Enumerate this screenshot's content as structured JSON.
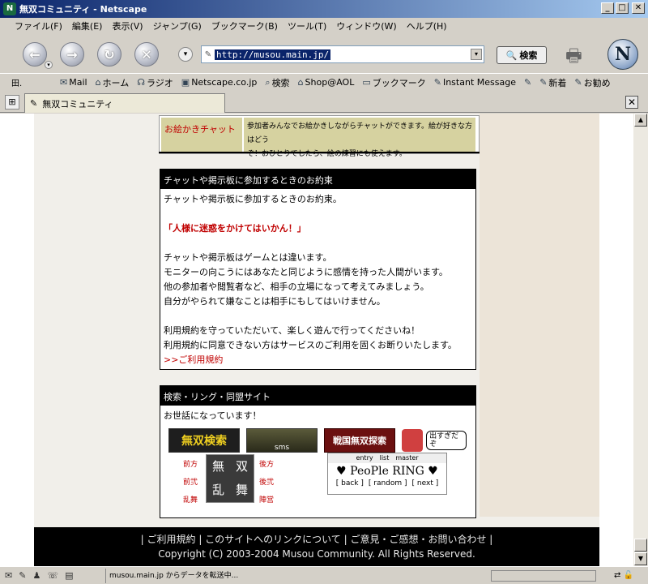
{
  "window": {
    "title": "無双コミュニティ - Netscape",
    "min": "_",
    "max": "□",
    "close": "✕"
  },
  "menu": [
    "ファイル(F)",
    "編集(E)",
    "表示(V)",
    "ジャンプ(G)",
    "ブックマーク(B)",
    "ツール(T)",
    "ウィンドウ(W)",
    "ヘルプ(H)"
  ],
  "nav": {
    "url": "http://musou.main.jp/",
    "search_label": "検索"
  },
  "personal": {
    "home_icon_label": "田.",
    "items": [
      "Mail",
      "ホーム",
      "ラジオ",
      "Netscape.co.jp",
      "検索",
      "Shop@AOL",
      "ブックマーク",
      "Instant Message",
      "",
      "新着",
      "お勧め"
    ]
  },
  "tab": {
    "title": "無双コミュニティ"
  },
  "content": {
    "oekaki_title": "お絵かきチャット",
    "oekaki_desc_1": "参加者みんなでお絵かきしながらチャットができます。絵が好きな方はどう",
    "oekaki_desc_2": "ぞ！おひとりでしたら、絵の練習にも使えます。",
    "rules_head": "チャットや掲示板に参加するときのお約束",
    "rules_intro": "チャットや掲示板に参加するときのお約束。",
    "rules_slogan": "「人様に迷惑をかけてはいかん！」",
    "rules_lines": [
      "チャットや掲示板はゲームとは違います。",
      "モニターの向こうにはあなたと同じように感情を持った人間がいます。",
      "他の参加者や閲覧者など、相手の立場になって考えてみましょう。",
      "自分がやられて嫌なことは相手にもしてはいけません。"
    ],
    "rules_outro_1": "利用規約を守っていただいて、楽しく遊んで行ってくださいね！",
    "rules_outro_2": "利用規約に同意できない方はサービスのご利用を固くお断りいたします。",
    "rules_link": ">>ご利用規約",
    "links_head": "検索・リング・同盟サイト",
    "links_intro": "お世話になっています！",
    "banner1": "無双検索",
    "banner2": "sms",
    "banner3": "戦国無双探索",
    "banner4_bubble": "出すぎだぞ",
    "muso_left": [
      "前方",
      "前弐",
      "乱舞"
    ],
    "muso_logo": [
      "無",
      "双",
      "乱",
      "舞"
    ],
    "muso_right": [
      "後方",
      "後弐",
      "陣営"
    ],
    "ring_tabs": [
      "entry",
      "list",
      "master"
    ],
    "ring_title": "♥ PeoPle RING ♥",
    "ring_nav": [
      "[ back ]",
      "[ random ]",
      "[ next ]"
    ]
  },
  "footer": {
    "links": "| ご利用規約 | このサイトへのリンクについて | ご意見・ご感想・お問い合わせ |",
    "copyright": "Copyright (C) 2003-2004 Musou Community. All Rights Reserved."
  },
  "status": {
    "message": "musou.main.jp からデータを転送中..."
  }
}
